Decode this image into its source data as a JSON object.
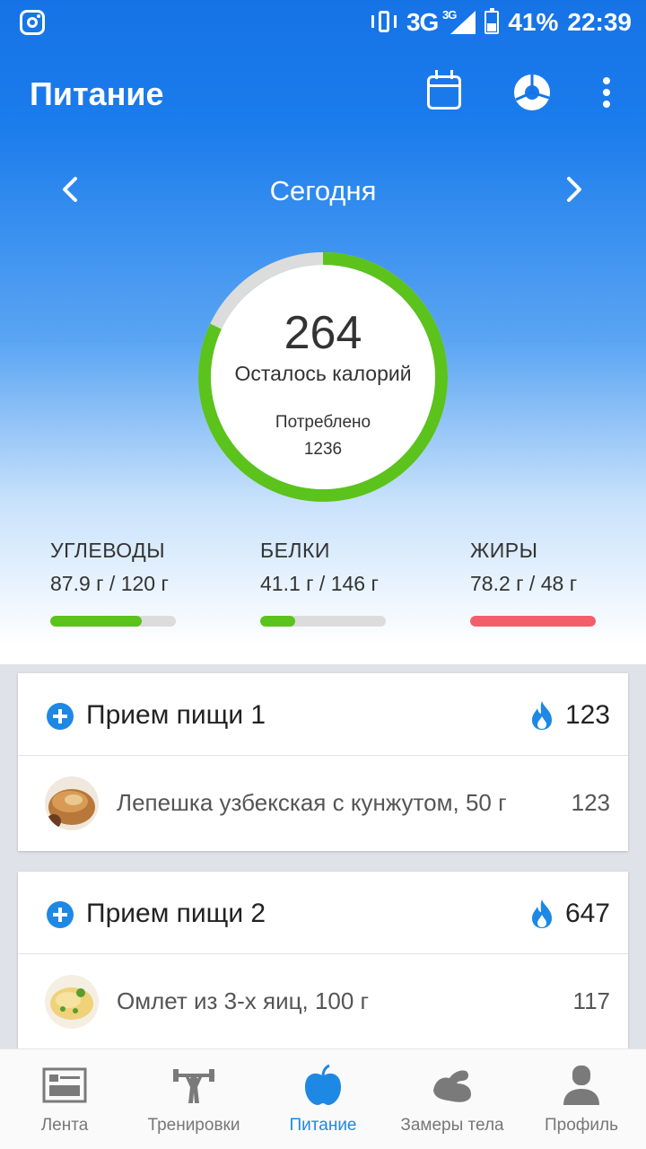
{
  "status_bar": {
    "network": "3G",
    "network_small": "3G",
    "battery": "41%",
    "time": "22:39"
  },
  "app_bar": {
    "title": "Питание"
  },
  "date_nav": {
    "label": "Сегодня"
  },
  "calories": {
    "remaining": "264",
    "remaining_label": "Осталось калорий",
    "consumed_label": "Потреблено",
    "consumed": "1236",
    "progress": 0.82
  },
  "macros": [
    {
      "name": "УГЛЕВОДЫ",
      "value": "87.9 г / 120 г",
      "progress": 0.73,
      "color": "#5cc21c"
    },
    {
      "name": "БЕЛКИ",
      "value": "41.1 г / 146 г",
      "progress": 0.28,
      "color": "#5cc21c"
    },
    {
      "name": "ЖИРЫ",
      "value": "78.2 г / 48 г",
      "progress": 1.0,
      "color": "#f25f6b"
    }
  ],
  "meals": [
    {
      "title": "Прием пищи 1",
      "kcal": "123",
      "items": [
        {
          "name": "Лепешка узбекская с кунжутом, 50 г",
          "kcal": "123"
        }
      ]
    },
    {
      "title": "Прием пищи 2",
      "kcal": "647",
      "items": [
        {
          "name": "Омлет из 3-х яиц, 100 г",
          "kcal": "117"
        }
      ]
    }
  ],
  "bottom_nav": {
    "feed": "Лента",
    "workouts": "Тренировки",
    "nutrition": "Питание",
    "measurements": "Замеры тела",
    "profile": "Профиль"
  },
  "colors": {
    "accent": "#1e88e5",
    "ring_green": "#5cc21c",
    "over_red": "#f25f6b"
  }
}
